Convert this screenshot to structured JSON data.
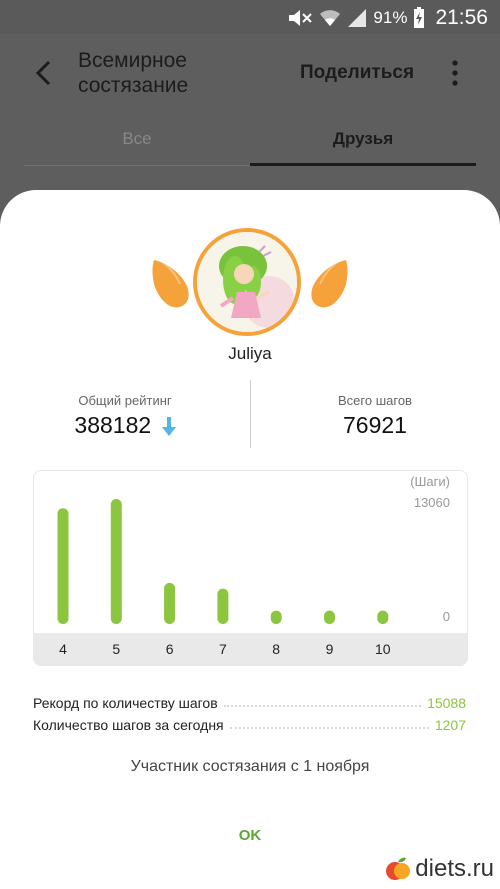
{
  "status_bar": {
    "battery": "91%",
    "time": "21:56"
  },
  "header": {
    "title_line1": "Всемирное",
    "title_line2": "состязание",
    "share_label": "Поделиться"
  },
  "tabs": [
    {
      "label": "Все"
    },
    {
      "label": "Друзья"
    }
  ],
  "profile": {
    "username": "Juliya"
  },
  "stats": {
    "rating_label": "Общий рейтинг",
    "rating_value": "388182",
    "steps_label": "Всего шагов",
    "steps_value": "76921"
  },
  "chart_data": {
    "type": "bar",
    "unit_label": "(Шаги)",
    "categories": [
      "4",
      "5",
      "6",
      "7",
      "8",
      "9",
      "10"
    ],
    "values": [
      12100,
      13060,
      4300,
      3700,
      1400,
      1400,
      1400
    ],
    "ylim": [
      0,
      13060
    ],
    "ytick_labels": [
      "13060",
      "0"
    ],
    "bar_color": "#8cc540"
  },
  "records": {
    "record_label": "Рекорд по количеству шагов",
    "record_value": "15088",
    "today_label": "Количество шагов за сегодня",
    "today_value": "1207"
  },
  "member_since": "Участник состязания с 1 ноября",
  "ok_label": "OK",
  "watermark": "diets.ru",
  "colors": {
    "accent_orange": "#f5a23b",
    "accent_green": "#8cc540",
    "arrow_blue": "#4fb7e8"
  }
}
